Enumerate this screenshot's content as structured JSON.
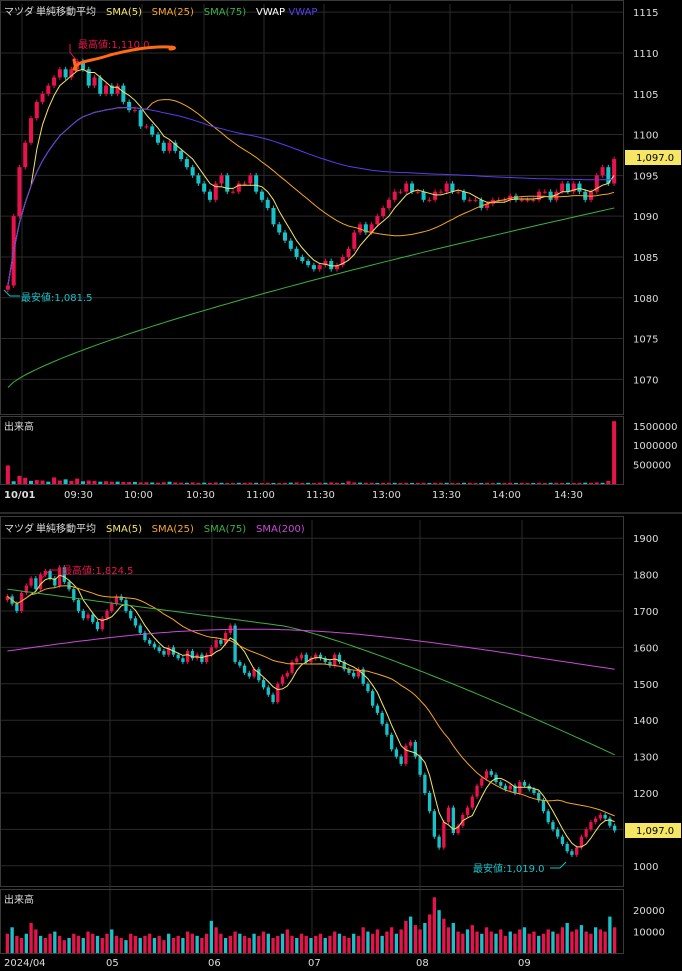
{
  "colors": {
    "background": "#000000",
    "border": "#3a3a3a",
    "grid": "#2a2a2a",
    "text": "#dddddd",
    "up": "#e8124c",
    "down": "#19c2c8",
    "volume_up": "#e8124c",
    "volume_down": "#19c2c8",
    "sma5": "#f5e663",
    "sma25": "#f5a623",
    "sma75": "#3cb043",
    "sma200": "#c84ad8",
    "vwap": "#ffffff",
    "vwap_line": "#5a3cf0",
    "price_tag_bg": "#f5e663",
    "annotation_high": "#e8124c",
    "annotation_low": "#19c2c8",
    "scribble": "#ff6a14"
  },
  "chart_data": [
    {
      "type": "candlestick",
      "panel": "intraday",
      "title": "マツダ",
      "indicator_label": "単純移動平均",
      "legend": [
        "SMA(5)",
        "SMA(25)",
        "SMA(75)",
        "VWAP",
        "VWAP"
      ],
      "ylim": [
        1066,
        1116
      ],
      "y_ticks": [
        1070,
        1075,
        1080,
        1085,
        1090,
        1095,
        1100,
        1105,
        1110,
        1115
      ],
      "x_ticks": [
        "10/01",
        "09:30",
        "10:00",
        "10:30",
        "11:00",
        "11:30",
        "13:00",
        "13:30",
        "14:00",
        "14:30"
      ],
      "last_price_label": "1,097.0",
      "last_price": 1097.0,
      "high_label": "最高値:1,110.0",
      "high": 1110.0,
      "low_label": "最安値:1,081.5",
      "low": 1081.5,
      "close_series": [
        1081.5,
        1090,
        1096,
        1099,
        1102,
        1104,
        1105,
        1106,
        1107,
        1108,
        1107,
        1108,
        1109,
        1108,
        1106,
        1107,
        1105,
        1106,
        1105,
        1106,
        1104,
        1103,
        1103,
        1101,
        1101,
        1100,
        1099,
        1098,
        1099,
        1098,
        1097,
        1096,
        1095,
        1094,
        1093,
        1092,
        1094,
        1095,
        1093,
        1093,
        1094,
        1094,
        1095,
        1093,
        1092,
        1091,
        1089,
        1088,
        1087,
        1086,
        1085,
        1084.5,
        1084,
        1083.5,
        1084,
        1084.5,
        1083.5,
        1084,
        1085,
        1086,
        1088,
        1089,
        1088,
        1089,
        1090,
        1091,
        1092,
        1093,
        1093,
        1094,
        1093,
        1093,
        1092,
        1092,
        1093,
        1093,
        1094,
        1093,
        1093,
        1092,
        1092,
        1092,
        1091,
        1091.5,
        1092,
        1092,
        1092,
        1092.5,
        1092,
        1092,
        1092,
        1092,
        1093,
        1093,
        1092,
        1093,
        1094,
        1093,
        1094,
        1093,
        1092,
        1093,
        1095,
        1096,
        1094,
        1097
      ]
    },
    {
      "type": "bar",
      "panel": "intraday-volume",
      "title": "出来高",
      "ylim": [
        0,
        1650000
      ],
      "y_ticks": [
        500000,
        1000000,
        1500000
      ],
      "y_tick_labels": [
        "500000",
        "1000000",
        "1500000"
      ],
      "values": [
        480000,
        70000,
        210000,
        160000,
        80000,
        100000,
        90000,
        60000,
        170000,
        90000,
        120000,
        80000,
        140000,
        70000,
        90000,
        80000,
        60000,
        70000,
        60000,
        60000,
        50000,
        50000,
        55000,
        40000,
        45000,
        40000,
        35000,
        45000,
        60000,
        40000,
        35000,
        30000,
        40000,
        30000,
        35000,
        30000,
        40000,
        30000,
        25000,
        25000,
        30000,
        30000,
        35000,
        30000,
        25000,
        30000,
        25000,
        25000,
        30000,
        35000,
        40000,
        25000,
        30000,
        25000,
        35000,
        30000,
        40000,
        30000,
        25000,
        70000,
        40000,
        35000,
        30000,
        30000,
        25000,
        30000,
        30000,
        30000,
        25000,
        30000,
        25000,
        25000,
        30000,
        25000,
        30000,
        30000,
        30000,
        25000,
        25000,
        30000,
        30000,
        25000,
        25000,
        30000,
        25000,
        30000,
        25000,
        30000,
        25000,
        30000,
        25000,
        25000,
        30000,
        25000,
        30000,
        30000,
        25000,
        30000,
        25000,
        30000,
        35000,
        30000,
        40000,
        30000,
        80000,
        1620000
      ]
    },
    {
      "type": "candlestick",
      "panel": "daily",
      "title": "マツダ",
      "indicator_label": "単純移動平均",
      "legend": [
        "SMA(5)",
        "SMA(25)",
        "SMA(75)",
        "SMA(200)"
      ],
      "ylim": [
        950,
        1950
      ],
      "y_ticks": [
        1000,
        1100,
        1200,
        1300,
        1400,
        1500,
        1600,
        1700,
        1800,
        1900
      ],
      "x_ticks": [
        "2024/04",
        "05",
        "06",
        "07",
        "08",
        "09"
      ],
      "last_price_label": "1,097.0",
      "last_price": 1097.0,
      "high_label": "最高値:1,824.5",
      "high": 1824.5,
      "low_label": "最安値:1,019.0",
      "low": 1019.0,
      "close_series": [
        1740,
        1720,
        1700,
        1750,
        1770,
        1790,
        1760,
        1800,
        1810,
        1790,
        1770,
        1820,
        1780,
        1760,
        1730,
        1700,
        1680,
        1690,
        1670,
        1650,
        1680,
        1700,
        1720,
        1740,
        1730,
        1700,
        1680,
        1660,
        1640,
        1620,
        1610,
        1600,
        1590,
        1580,
        1600,
        1580,
        1570,
        1560,
        1590,
        1570,
        1580,
        1560,
        1580,
        1600,
        1620,
        1610,
        1640,
        1660,
        1560,
        1550,
        1530,
        1520,
        1540,
        1510,
        1490,
        1470,
        1450,
        1500,
        1520,
        1530,
        1560,
        1570,
        1580,
        1560,
        1570,
        1580,
        1570,
        1560,
        1550,
        1580,
        1560,
        1540,
        1530,
        1520,
        1540,
        1500,
        1480,
        1440,
        1420,
        1390,
        1360,
        1320,
        1300,
        1280,
        1330,
        1340,
        1300,
        1250,
        1200,
        1150,
        1080,
        1050,
        1120,
        1160,
        1090,
        1110,
        1140,
        1160,
        1190,
        1220,
        1240,
        1260,
        1250,
        1230,
        1220,
        1210,
        1220,
        1200,
        1230,
        1220,
        1210,
        1200,
        1180,
        1150,
        1120,
        1100,
        1080,
        1060,
        1040,
        1030,
        1050,
        1080,
        1100,
        1120,
        1130,
        1140,
        1130,
        1110,
        1097
      ]
    },
    {
      "type": "bar",
      "panel": "daily-volume",
      "title": "出来高",
      "ylim": [
        0,
        28000
      ],
      "y_ticks": [
        10000,
        20000
      ],
      "y_tick_labels": [
        "10000",
        "20000"
      ],
      "values": [
        9000,
        12000,
        8000,
        7000,
        9000,
        14000,
        11000,
        8000,
        7000,
        9000,
        10000,
        8000,
        6000,
        7000,
        9000,
        8000,
        7000,
        10000,
        9000,
        8000,
        7000,
        9000,
        11000,
        8000,
        7000,
        6000,
        9000,
        8000,
        7000,
        8000,
        9000,
        7000,
        8000,
        6000,
        9000,
        7000,
        8000,
        7000,
        10000,
        9000,
        8000,
        7000,
        9000,
        15000,
        12000,
        9000,
        7000,
        8000,
        10000,
        9000,
        8000,
        7000,
        9000,
        8000,
        10000,
        9000,
        7000,
        8000,
        9000,
        11000,
        8000,
        7000,
        9000,
        8000,
        7000,
        8000,
        9000,
        7000,
        8000,
        10000,
        9000,
        8000,
        7000,
        9000,
        8000,
        12000,
        10000,
        9000,
        11000,
        8000,
        10000,
        12000,
        9000,
        11000,
        15000,
        17000,
        13000,
        11000,
        14000,
        18000,
        26000,
        20000,
        16000,
        12000,
        14000,
        10000,
        9000,
        11000,
        13000,
        10000,
        9000,
        12000,
        10000,
        9000,
        11000,
        8000,
        10000,
        9000,
        11000,
        12000,
        9000,
        10000,
        8000,
        9000,
        11000,
        10000,
        9000,
        12000,
        14000,
        10000,
        11000,
        13000,
        10000,
        9000,
        12000,
        11000,
        10000,
        17000,
        12000
      ]
    }
  ]
}
